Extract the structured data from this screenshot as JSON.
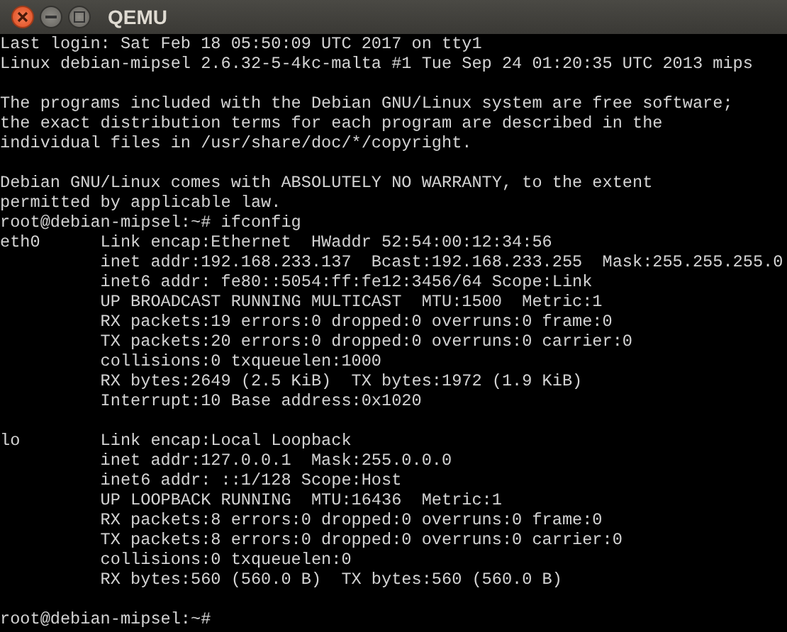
{
  "window": {
    "title": "QEMU"
  },
  "terminal": {
    "blocks": [
      [
        "Last login: Sat Feb 18 05:50:09 UTC 2017 on tty1",
        "Linux debian-mipsel 2.6.32-5-4kc-malta #1 Tue Sep 24 01:20:35 UTC 2013 mips"
      ],
      [
        "The programs included with the Debian GNU/Linux system are free software;",
        "the exact distribution terms for each program are described in the",
        "individual files in /usr/share/doc/*/copyright."
      ],
      [
        "Debian GNU/Linux comes with ABSOLUTELY NO WARRANTY, to the extent",
        "permitted by applicable law.",
        "root@debian-mipsel:~# ifconfig",
        "eth0      Link encap:Ethernet  HWaddr 52:54:00:12:34:56",
        "          inet addr:192.168.233.137  Bcast:192.168.233.255  Mask:255.255.255.0",
        "          inet6 addr: fe80::5054:ff:fe12:3456/64 Scope:Link",
        "          UP BROADCAST RUNNING MULTICAST  MTU:1500  Metric:1",
        "          RX packets:19 errors:0 dropped:0 overruns:0 frame:0",
        "          TX packets:20 errors:0 dropped:0 overruns:0 carrier:0",
        "          collisions:0 txqueuelen:1000",
        "          RX bytes:2649 (2.5 KiB)  TX bytes:1972 (1.9 KiB)",
        "          Interrupt:10 Base address:0x1020"
      ],
      [
        "lo        Link encap:Local Loopback",
        "          inet addr:127.0.0.1  Mask:255.0.0.0",
        "          inet6 addr: ::1/128 Scope:Host",
        "          UP LOOPBACK RUNNING  MTU:16436  Metric:1",
        "          RX packets:8 errors:0 dropped:0 overruns:0 frame:0",
        "          TX packets:8 errors:0 dropped:0 overruns:0 carrier:0",
        "          collisions:0 txqueuelen:0",
        "          RX bytes:560 (560.0 B)  TX bytes:560 (560.0 B)"
      ],
      [
        "root@debian-mipsel:~#"
      ]
    ]
  }
}
